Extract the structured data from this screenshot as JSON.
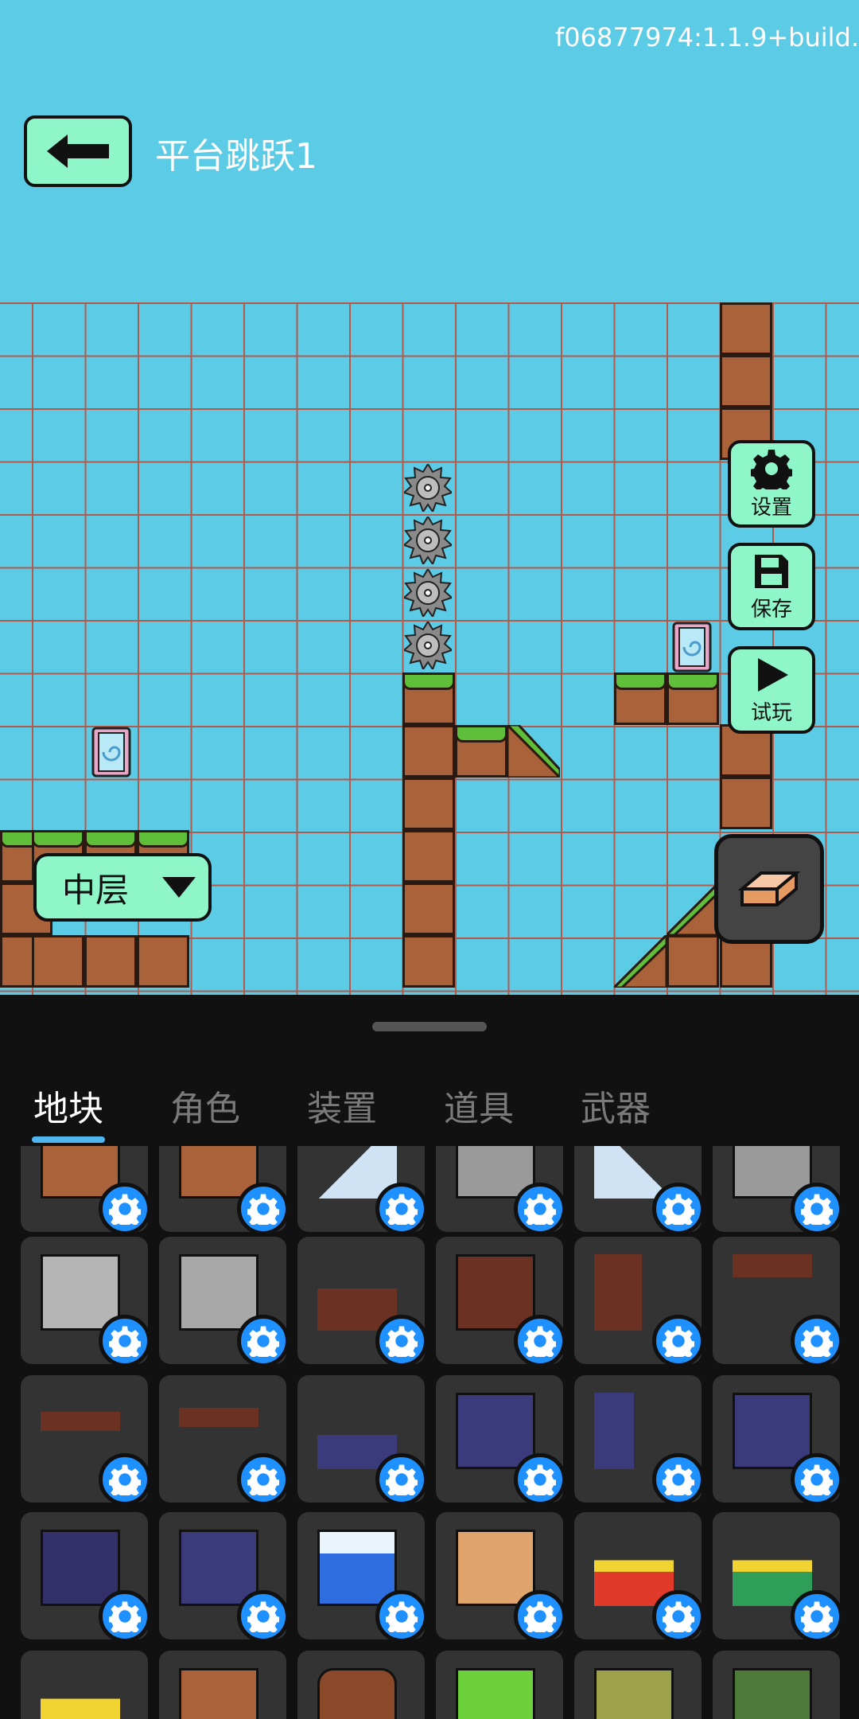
{
  "header": {
    "version": "f06877974:1.1.9+build.",
    "level_title": "平台跳跃1"
  },
  "side_buttons": {
    "settings": "设置",
    "save": "保存",
    "play": "试玩"
  },
  "layer": {
    "selected": "中层"
  },
  "tabs": [
    {
      "label": "地块",
      "active": true
    },
    {
      "label": "角色",
      "active": false
    },
    {
      "label": "装置",
      "active": false
    },
    {
      "label": "道具",
      "active": false
    },
    {
      "label": "武器",
      "active": false
    }
  ],
  "palette": {
    "tiles": [
      "dirt-spots",
      "dirt-bone",
      "ice-slope",
      "stone-brick",
      "ice-slope-2",
      "stone-brick-2",
      "cracked-stone",
      "stone-circle",
      "wood-stumps",
      "wood-logs",
      "wood-stumps-2",
      "wood-bracket",
      "wood-plank",
      "wood-bracket-2",
      "spiral-small",
      "spiral-grass",
      "spiral-stack",
      "purple-block",
      "spiral-moss",
      "spiral-dark",
      "ice-water",
      "wood-crate-light",
      "lava-red",
      "lava-green",
      "gold-pile",
      "wood-crate",
      "barrel",
      "green-block",
      "olive-block",
      "moss-block"
    ]
  },
  "colors": {
    "sky": "#5ccbe6",
    "accent_button": "#8ff6c9",
    "panel_bg": "#111111",
    "config_badge": "#1e90ff"
  }
}
